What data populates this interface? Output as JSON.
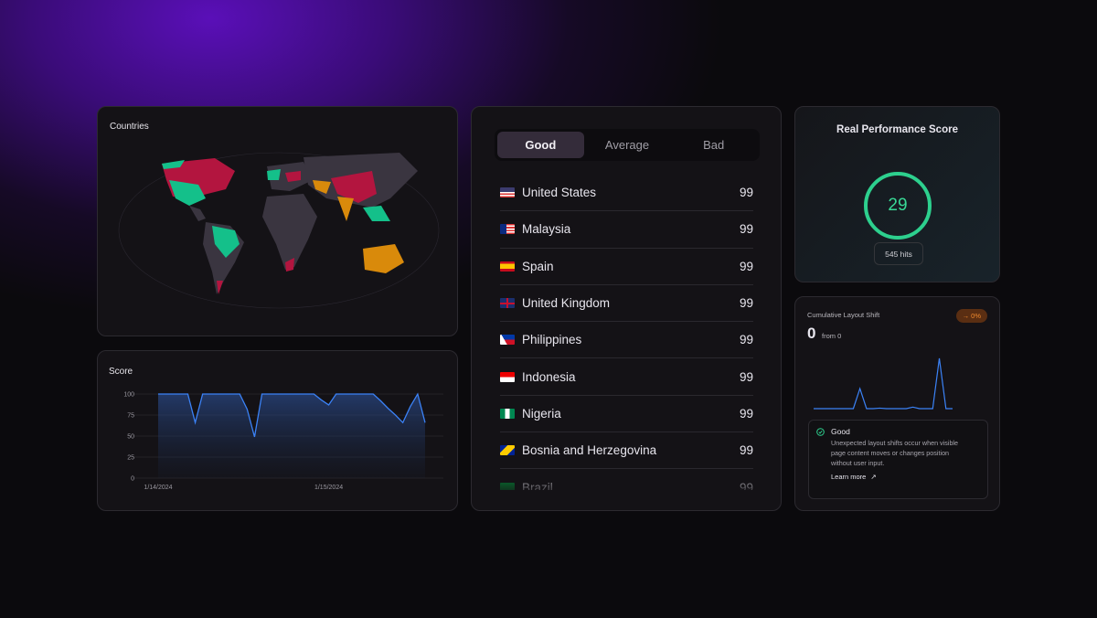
{
  "map": {
    "title": "Countries",
    "colors": {
      "good": "#14c08a",
      "bad": "#b3153f",
      "average": "#d98a0b",
      "none": "#3a3540"
    }
  },
  "score": {
    "title": "Score"
  },
  "chart_data": {
    "type": "area",
    "title": "Score",
    "yticks": [
      0,
      25,
      50,
      75,
      100
    ],
    "ylim": [
      0,
      100
    ],
    "xtick_labels": [
      "1/14/2024",
      "1/15/2024"
    ],
    "grid": true,
    "color": "#3b82f6",
    "values": [
      100,
      100,
      100,
      100,
      100,
      66,
      100,
      100,
      100,
      100,
      100,
      100,
      82,
      49,
      100,
      100,
      100,
      100,
      100,
      100,
      100,
      100,
      93,
      87,
      100,
      100,
      100,
      100,
      100,
      100,
      92,
      83,
      75,
      66,
      85,
      100,
      66
    ]
  },
  "list": {
    "tabs": [
      {
        "label": "Good",
        "active": true
      },
      {
        "label": "Average"
      },
      {
        "label": "Bad"
      }
    ],
    "rows": [
      {
        "country": "United States",
        "value": "99",
        "flag": "us"
      },
      {
        "country": "Malaysia",
        "value": "99",
        "flag": "my"
      },
      {
        "country": "Spain",
        "value": "99",
        "flag": "es"
      },
      {
        "country": "United Kingdom",
        "value": "99",
        "flag": "gb"
      },
      {
        "country": "Philippines",
        "value": "99",
        "flag": "ph"
      },
      {
        "country": "Indonesia",
        "value": "99",
        "flag": "id"
      },
      {
        "country": "Nigeria",
        "value": "99",
        "flag": "ng"
      },
      {
        "country": "Bosnia and Herzegovina",
        "value": "99",
        "flag": "ba"
      },
      {
        "country": "Brazil",
        "value": "99",
        "flag": "br"
      }
    ]
  },
  "perf": {
    "title": "Real Performance Score",
    "score": "29",
    "hits": "545 hits",
    "color": "#2dd08e"
  },
  "cls": {
    "title": "Cumulative Layout Shift",
    "value": "0",
    "from": "from 0",
    "badge": "→ 0%",
    "spark": [
      0,
      0,
      0,
      0,
      0,
      0,
      0,
      0.4,
      0,
      0,
      0.01,
      0,
      0,
      0,
      0,
      0.03,
      0,
      0,
      0,
      1,
      0,
      0
    ],
    "status": "Good",
    "description": "Unexpected layout shifts occur when visible page content moves or changes position without user input.",
    "link": "Learn more"
  }
}
